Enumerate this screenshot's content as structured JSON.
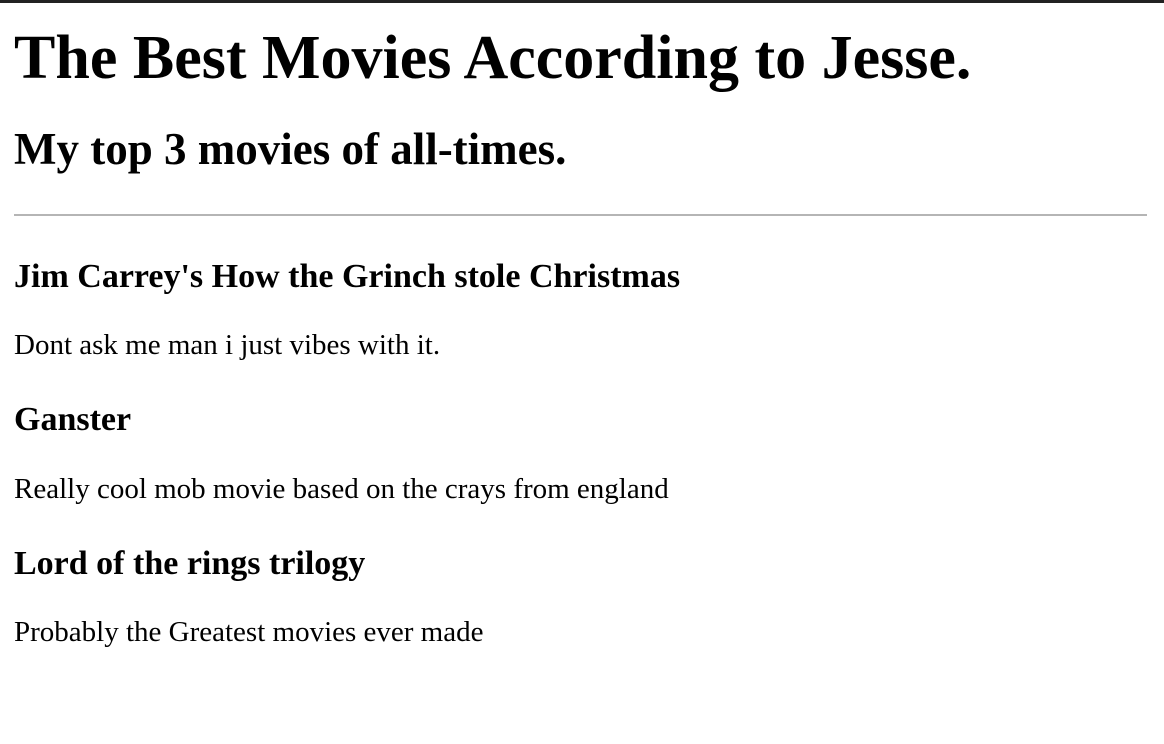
{
  "page": {
    "title": "The Best Movies According to Jesse.",
    "subtitle": "My top 3 movies of all-times."
  },
  "movies": [
    {
      "title": "Jim Carrey's How the Grinch stole Christmas",
      "description": "Dont ask me man i just vibes with it."
    },
    {
      "title": "Ganster",
      "description": "Really cool mob movie based on the crays from england"
    },
    {
      "title": "Lord of the rings trilogy",
      "description": "Probably the Greatest movies ever made"
    }
  ]
}
